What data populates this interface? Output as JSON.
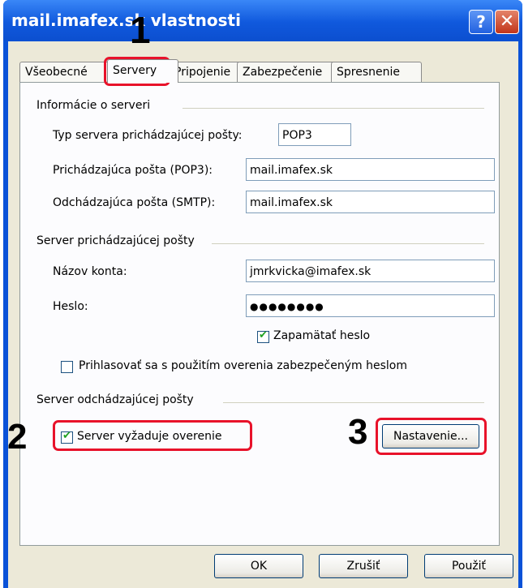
{
  "window": {
    "title": "mail.imafex.sk vlastnosti",
    "help_glyph": "?",
    "close_glyph": "✕"
  },
  "tabs": [
    {
      "label": "Všeobecné"
    },
    {
      "label": "Servery"
    },
    {
      "label": "Pripojenie"
    },
    {
      "label": "Zabezpečenie"
    },
    {
      "label": "Spresnenie"
    }
  ],
  "server_info": {
    "group_title": "Informácie o serveri",
    "type_label": "Typ servera prichádzajúcej pošty:",
    "type_value": "POP3",
    "incoming_label": "Prichádzajúca pošta (POP3):",
    "incoming_value": "mail.imafex.sk",
    "outgoing_label": "Odchádzajúca pošta (SMTP):",
    "outgoing_value": "mail.imafex.sk"
  },
  "incoming_server": {
    "group_title": "Server prichádzajúcej pošty",
    "account_label": "Názov konta:",
    "account_value": "jmrkvicka@imafex.sk",
    "password_label": "Heslo:",
    "password_value": "●●●●●●●●",
    "remember_label": "Zapamätať heslo",
    "spa_label": "Prihlasovať sa s použitím overenia zabezpečeným heslom"
  },
  "outgoing_server": {
    "group_title": "Server odchádzajúcej pošty",
    "auth_label": "Server vyžaduje overenie",
    "settings_button": "Nastavenie..."
  },
  "annotations": {
    "one": "1",
    "two": "2",
    "three": "3",
    "highlight_color": "#e8122a"
  },
  "footer": {
    "ok": "OK",
    "cancel": "Zrušiť",
    "apply": "Použiť"
  }
}
